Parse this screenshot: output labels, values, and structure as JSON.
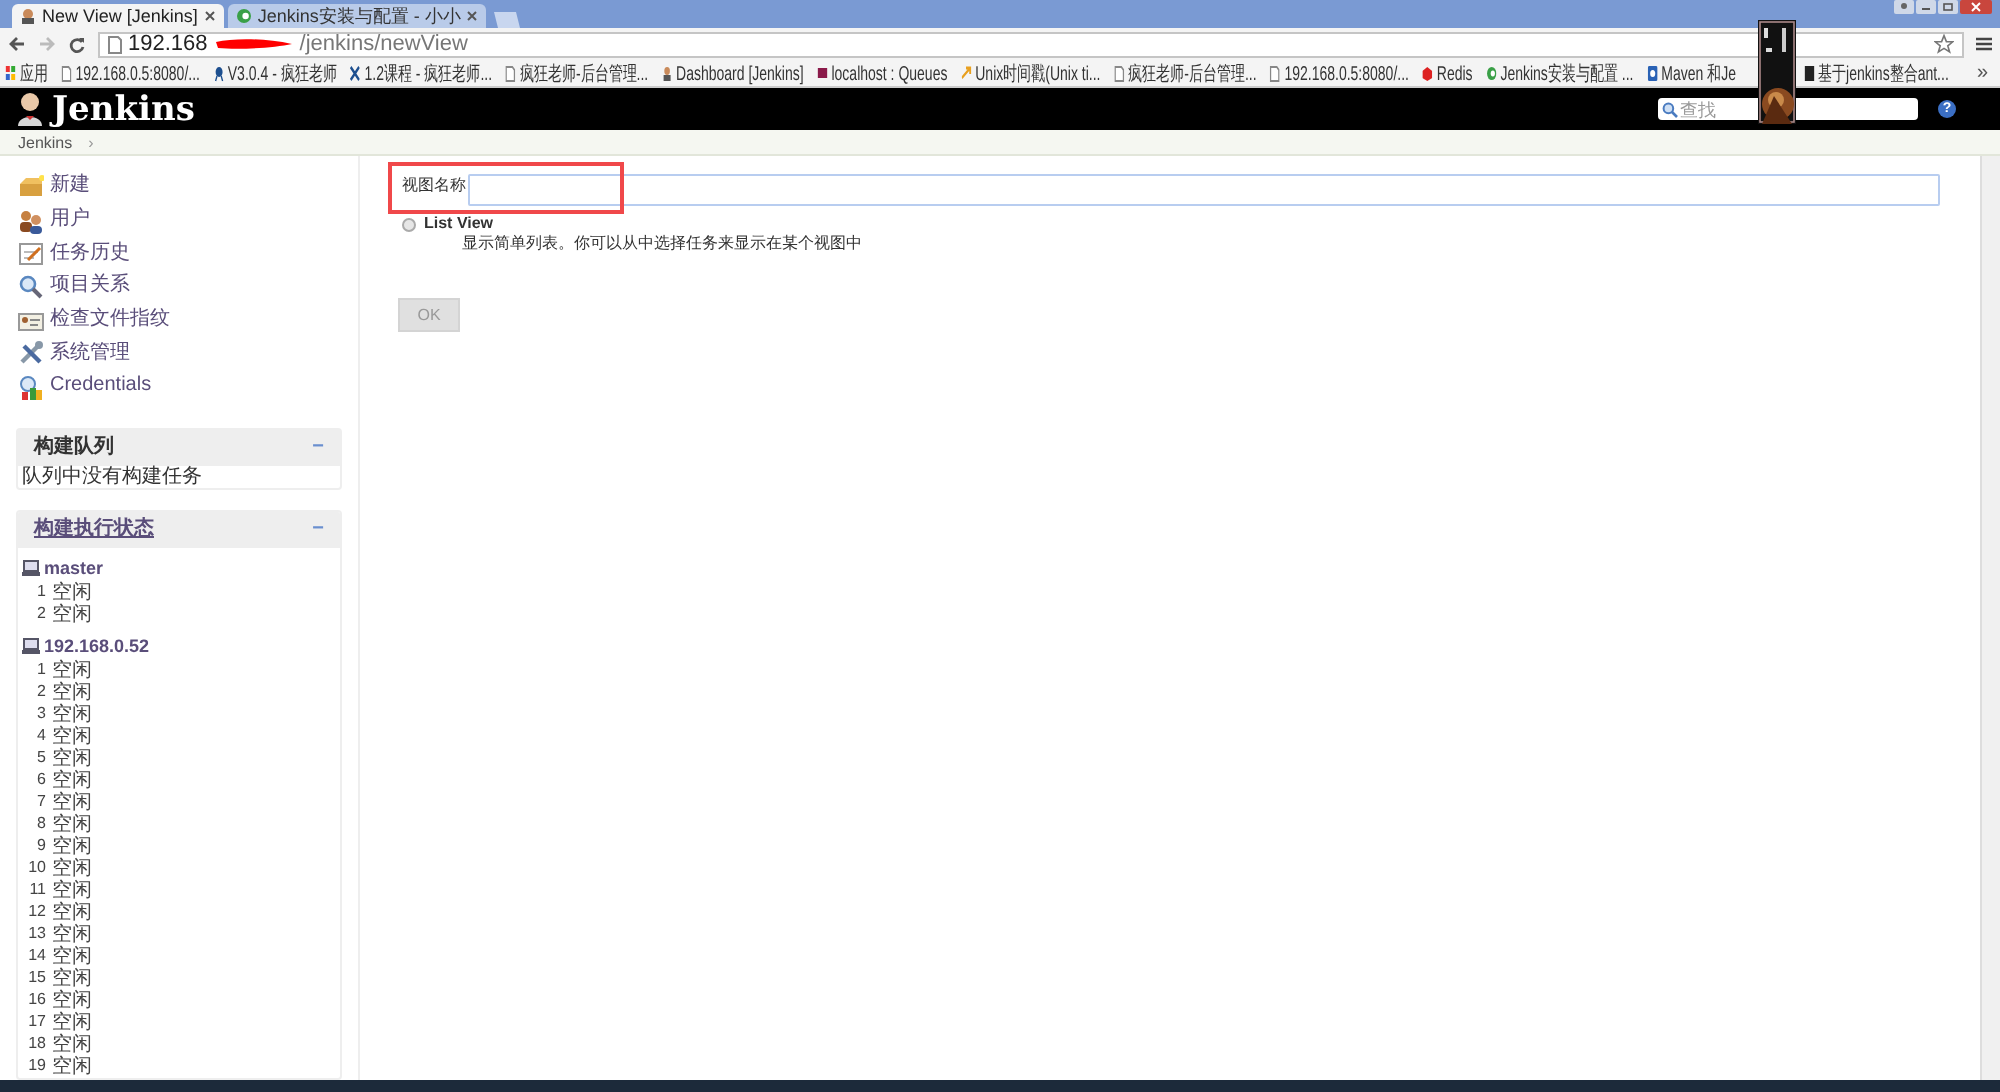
{
  "browser": {
    "tabs": [
      {
        "title": "New View [Jenkins]",
        "selected": true
      },
      {
        "title": "Jenkins安装与配置 - 小小",
        "selected": false
      }
    ],
    "address": {
      "host": "192.168",
      "path": "/jenkins/newView"
    },
    "bookmarks": [
      "应用",
      "192.168.0.5:8080/...",
      "V3.0.4 - 疯狂老师",
      "1.2课程 - 疯狂老师...",
      "疯狂老师-后台管理...",
      "Dashboard [Jenkins]",
      "localhost : Queues",
      "Unix时间戳(Unix ti...",
      "疯狂老师-后台管理...",
      "192.168.0.5:8080/...",
      "Redis",
      "Jenkins安装与配置 ...",
      "Maven 和Je",
      "基于jenkins整合ant..."
    ],
    "more": "»"
  },
  "header": {
    "logo": "Jenkins",
    "search_placeholder": "查找",
    "help": "?"
  },
  "breadcrumb": {
    "items": [
      "Jenkins"
    ],
    "separator": "›"
  },
  "tasks": [
    "新建",
    "用户",
    "任务历史",
    "项目关系",
    "检查文件指纹",
    "系统管理",
    "Credentials"
  ],
  "build_queue": {
    "title": "构建队列",
    "collapse": "−",
    "message": "队列中没有构建任务"
  },
  "executors": {
    "title": "构建执行状态",
    "collapse": "−",
    "nodes": [
      {
        "name": "master",
        "slots": [
          {
            "number": "1",
            "status": "空闲"
          },
          {
            "number": "2",
            "status": "空闲"
          }
        ]
      },
      {
        "name": "192.168.0.52",
        "slots": [
          {
            "number": "1",
            "status": "空闲"
          },
          {
            "number": "2",
            "status": "空闲"
          },
          {
            "number": "3",
            "status": "空闲"
          },
          {
            "number": "4",
            "status": "空闲"
          },
          {
            "number": "5",
            "status": "空闲"
          },
          {
            "number": "6",
            "status": "空闲"
          },
          {
            "number": "7",
            "status": "空闲"
          },
          {
            "number": "8",
            "status": "空闲"
          },
          {
            "number": "9",
            "status": "空闲"
          },
          {
            "number": "10",
            "status": "空闲"
          },
          {
            "number": "11",
            "status": "空闲"
          },
          {
            "number": "12",
            "status": "空闲"
          },
          {
            "number": "13",
            "status": "空闲"
          },
          {
            "number": "14",
            "status": "空闲"
          },
          {
            "number": "15",
            "status": "空闲"
          },
          {
            "number": "16",
            "status": "空闲"
          },
          {
            "number": "17",
            "status": "空闲"
          },
          {
            "number": "18",
            "status": "空闲"
          },
          {
            "number": "19",
            "status": "空闲"
          }
        ]
      }
    ]
  },
  "form": {
    "name_label": "视图名称",
    "view_types": [
      {
        "label": "List View",
        "description": "显示简单列表。你可以从中选择任务来显示在某个视图中",
        "selected": false
      }
    ],
    "ok": {
      "label": "OK",
      "disabled": true
    }
  }
}
